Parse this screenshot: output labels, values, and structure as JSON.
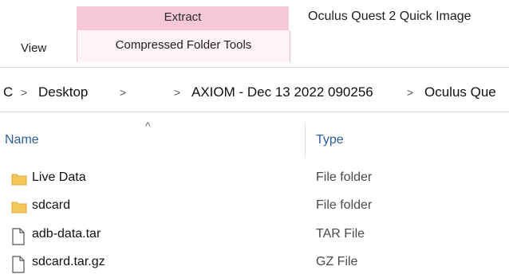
{
  "ribbon": {
    "extract_label": "Extract",
    "compressed_tools_label": "Compressed Folder Tools",
    "view_label": "View",
    "window_title": "Oculus Quest 2 Quick Image"
  },
  "address_bar": {
    "crumbs": [
      "C",
      "Desktop",
      "AXIOM - Dec 13 2022 090256",
      "Oculus Que"
    ],
    "separator": ">"
  },
  "columns": {
    "name": "Name",
    "type": "Type",
    "sort_indicator": "^"
  },
  "files": [
    {
      "name": "Live Data",
      "type": "File folder",
      "icon": "folder-icon"
    },
    {
      "name": "sdcard",
      "type": "File folder",
      "icon": "folder-icon"
    },
    {
      "name": "adb-data.tar",
      "type": "TAR File",
      "icon": "file-icon"
    },
    {
      "name": "sdcard.tar.gz",
      "type": "GZ File",
      "icon": "file-icon"
    }
  ],
  "colors": {
    "extract_tab": "#f5c7d7",
    "header_text": "#2c5f9e",
    "folder": "#f2c85b"
  }
}
